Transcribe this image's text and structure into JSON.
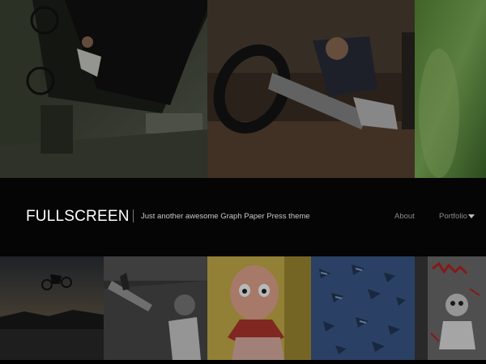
{
  "header": {
    "site_title": "FULLSCREEN",
    "tagline": "Just another awesome Graph Paper Press theme"
  },
  "nav": {
    "items": [
      {
        "label": "About"
      },
      {
        "label": "Portfolio",
        "has_dropdown": true
      }
    ]
  },
  "gallery": {
    "top_row": [
      {
        "subject": "bmx rider under bridge"
      },
      {
        "subject": "bmx rider indoor ramp"
      },
      {
        "subject": "green blur"
      }
    ],
    "bottom_row": [
      {
        "subject": "bmx rider at sunset"
      },
      {
        "subject": "child with slingshot"
      },
      {
        "subject": "vintage doll"
      },
      {
        "subject": "blue textured surface"
      },
      {
        "subject": "graffiti wall"
      }
    ]
  },
  "colors": {
    "background": "#000000",
    "header_bg": "#050505",
    "title": "#ffffff",
    "tagline": "#c8c8c8",
    "nav": "#8a8a8a"
  }
}
